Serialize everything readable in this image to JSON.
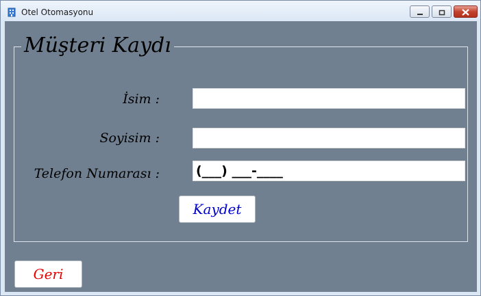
{
  "window": {
    "title": "Otel Otomasyonu",
    "app_icon": "building-icon",
    "controls": {
      "minimize_icon": "minimize-icon",
      "maximize_icon": "maximize-icon",
      "close_icon": "close-icon"
    }
  },
  "form": {
    "group_title": "Müşteri Kaydı",
    "fields": {
      "isim_label": "İsim :",
      "isim_value": "",
      "soyisim_label": "Soyisim :",
      "soyisim_value": "",
      "telefon_label": "Telefon Numarası :",
      "telefon_value": "(___) ___-____"
    },
    "save_button": "Kaydet",
    "back_button": "Geri"
  },
  "colors": {
    "client_background": "#708090",
    "save_text": "#0000cc",
    "back_text": "#e60000"
  }
}
